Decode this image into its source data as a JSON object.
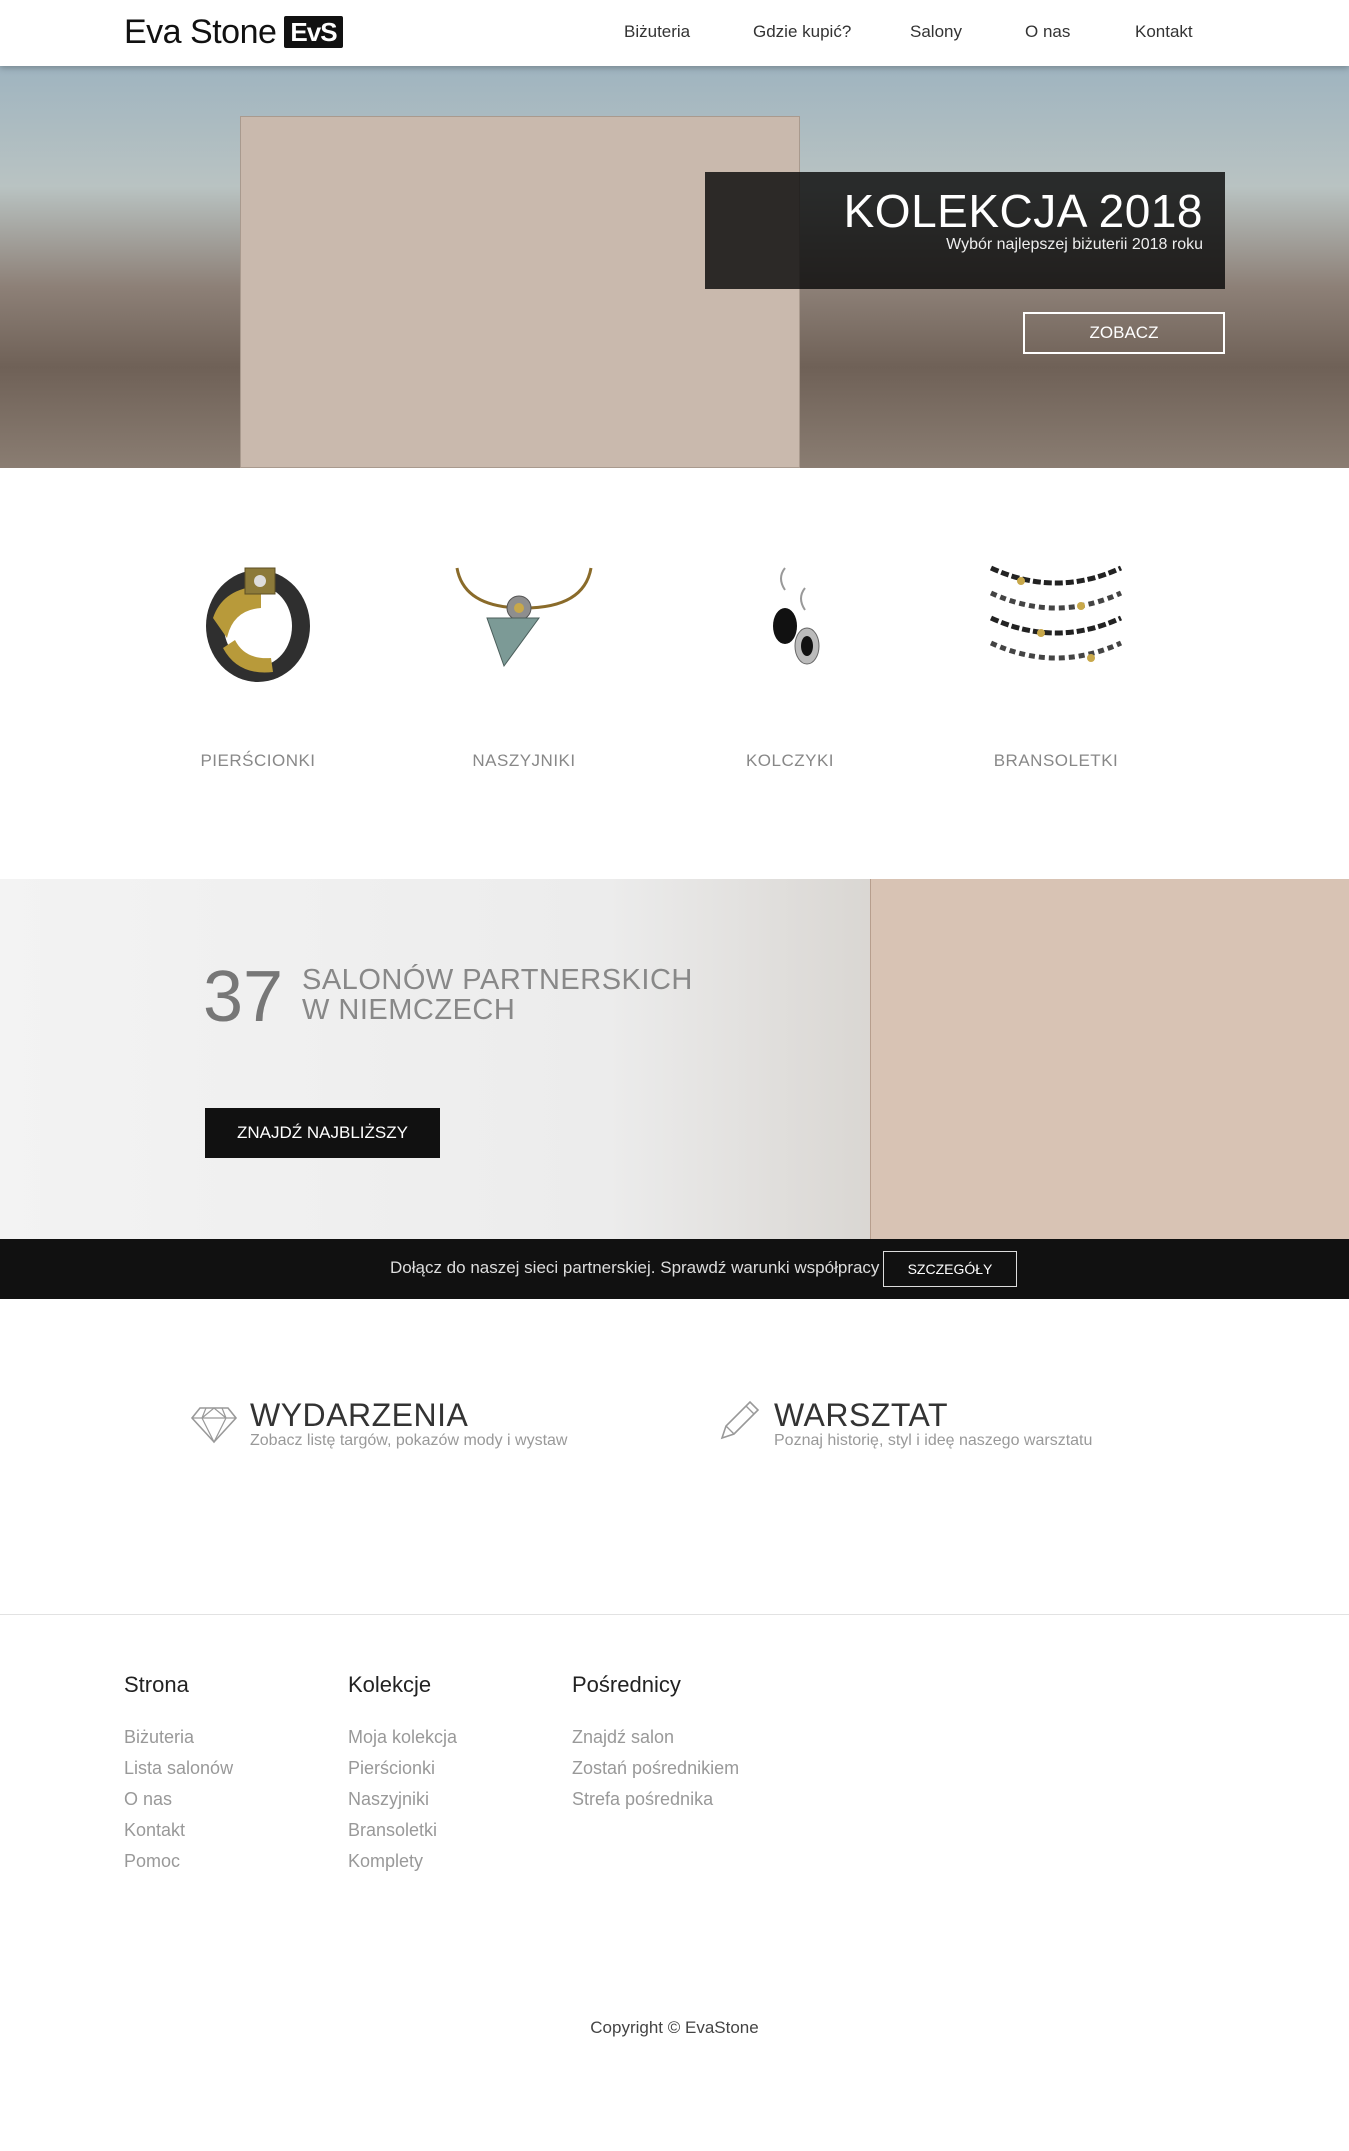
{
  "header": {
    "logo_text": "Eva Stone",
    "logo_mark": "EvS",
    "nav": [
      "Biżuteria",
      "Gdzie kupić?",
      "Salony",
      "O nas",
      "Kontakt"
    ]
  },
  "hero": {
    "title": "KOLEKCJA 2018",
    "subtitle": "Wybór najlepszej biżuterii 2018 roku",
    "button": "ZOBACZ"
  },
  "categories": [
    {
      "label": "PIERŚCIONKI",
      "icon": "ring-icon"
    },
    {
      "label": "NASZYJNIKI",
      "icon": "necklace-icon"
    },
    {
      "label": "KOLCZYKI",
      "icon": "earrings-icon"
    },
    {
      "label": "BRANSOLETKI",
      "icon": "bracelet-icon"
    }
  ],
  "partners": {
    "count": "37",
    "line1": "SALONÓW PARTNERSKICH",
    "line2": "W NIEMCZECH",
    "button": "ZNAJDŹ NAJBLIŻSZY"
  },
  "join": {
    "text": "Dołącz do naszej sieci partnerskiej. Sprawdź warunki współpracy",
    "button": "SZCZEGÓŁY"
  },
  "features": [
    {
      "title": "WYDARZENIA",
      "subtitle": "Zobacz listę targów, pokazów mody i wystaw",
      "icon": "diamond-icon"
    },
    {
      "title": "WARSZTAT",
      "subtitle": "Poznaj historię, styl i ideę naszego warsztatu",
      "icon": "pencil-icon"
    }
  ],
  "footer": {
    "columns": [
      {
        "title": "Strona",
        "links": [
          "Biżuteria",
          "Lista salonów",
          "O nas",
          "Kontakt",
          "Pomoc"
        ]
      },
      {
        "title": "Kolekcje",
        "links": [
          "Moja kolekcja",
          "Pierścionki",
          "Naszyjniki",
          "Bransoletki",
          "Komplety"
        ]
      },
      {
        "title": "Pośrednicy",
        "links": [
          "Znajdź salon",
          "Zostań pośrednikiem",
          "Strefa pośrednika"
        ]
      }
    ],
    "copyright": "Copyright © EvaStone"
  }
}
